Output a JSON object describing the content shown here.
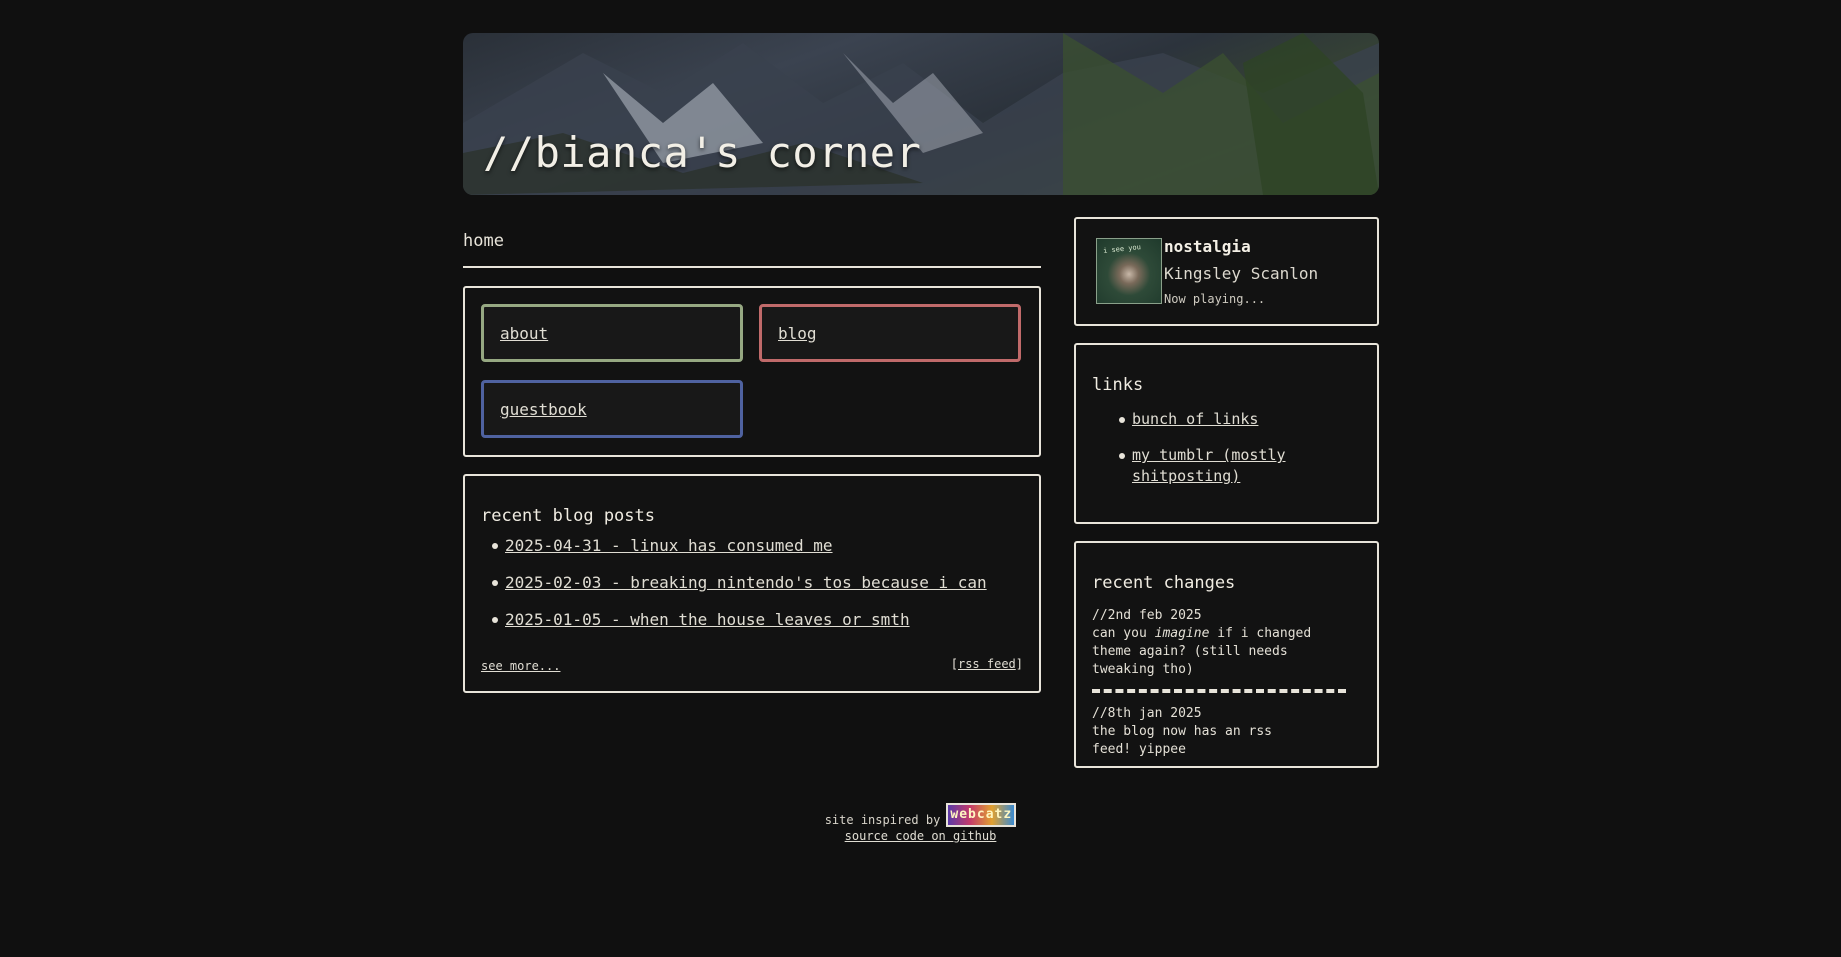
{
  "site": {
    "title": "//bianca's corner"
  },
  "breadcrumb": {
    "label": "home"
  },
  "nav": {
    "about": "about",
    "blog": "blog",
    "guestbook": "guestbook",
    "colors": {
      "about": "#96a882",
      "blog": "#c06a6a",
      "guestbook": "#4f62a0"
    }
  },
  "posts": {
    "title": "recent blog posts",
    "items": [
      {
        "label": "2025-04-31 - linux has consumed me"
      },
      {
        "label": "2025-02-03 - breaking nintendo's tos because i can"
      },
      {
        "label": "2025-01-05 - when the house leaves or smth"
      }
    ],
    "see_more": "see more...",
    "rss_open": "[",
    "rss_label": "rss feed",
    "rss_close": "]"
  },
  "player": {
    "track": "nostalgia",
    "artist": "Kingsley Scanlon",
    "status": "Now playing...",
    "album_text": "i see you"
  },
  "links": {
    "title": "links",
    "items": [
      {
        "label": "bunch of links"
      },
      {
        "label": "my tumblr (mostly shitposting)"
      }
    ]
  },
  "changes": {
    "title": "recent changes",
    "items": [
      {
        "date": "//2nd feb 2025",
        "text_before": "can you ",
        "text_em": "imagine",
        "text_after": " if i changed theme again? (still needs tweaking tho)"
      },
      {
        "date": "//8th jan 2025",
        "text": "the blog now has an rss feed! yippee"
      }
    ]
  },
  "footer": {
    "inspired": "site inspired by",
    "badge": "webcatz",
    "source": "source code on github"
  }
}
